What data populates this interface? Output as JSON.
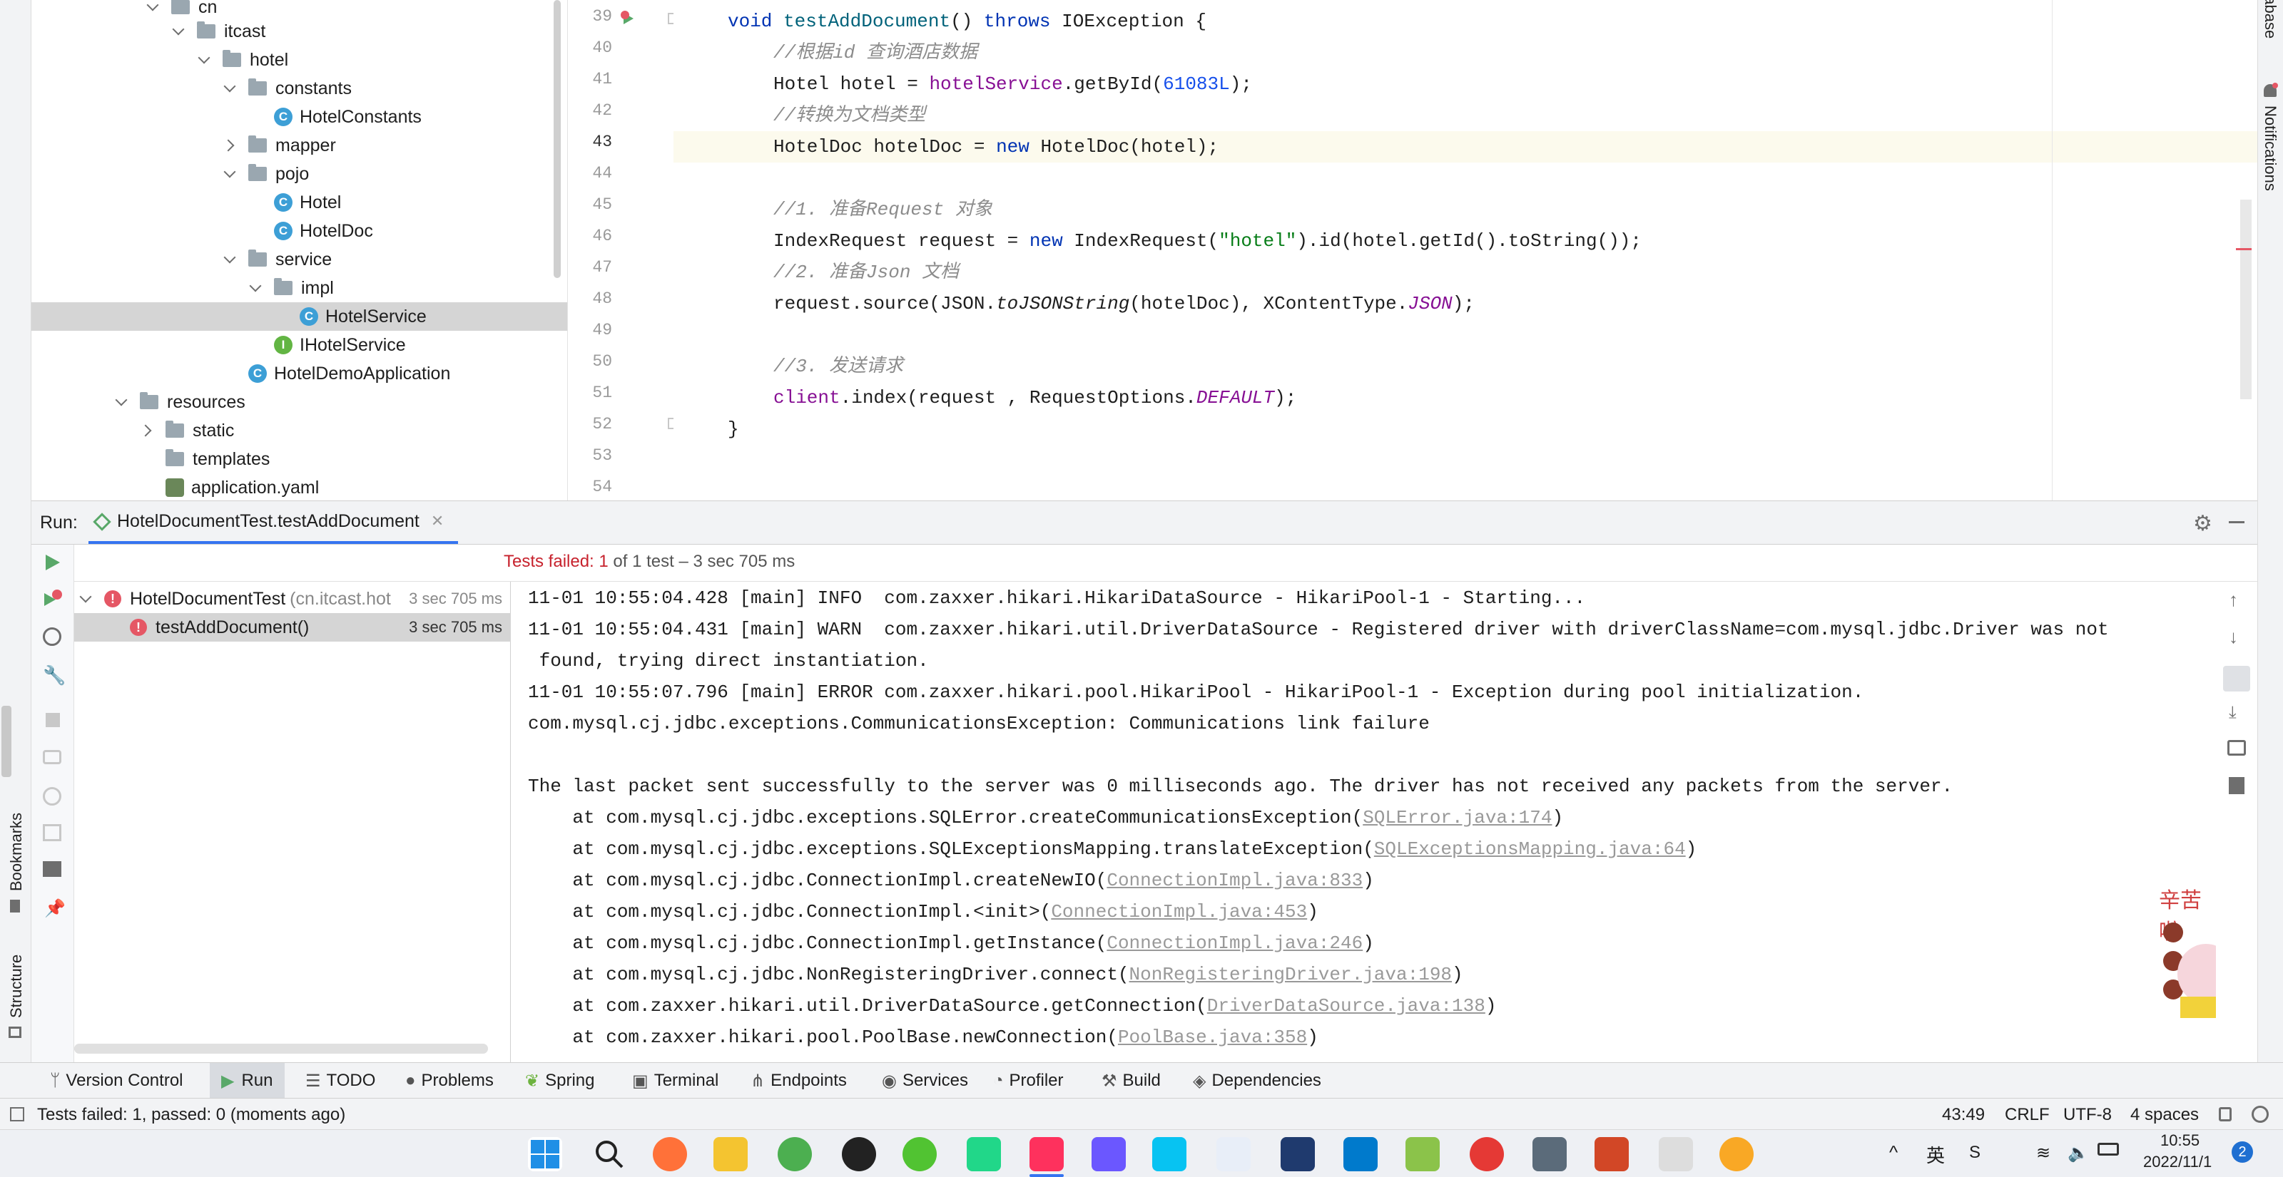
{
  "project_tree": {
    "items": [
      {
        "label": "cn",
        "type": "folder",
        "expanded": true
      },
      {
        "label": "itcast",
        "type": "folder",
        "expanded": true
      },
      {
        "label": "hotel",
        "type": "folder",
        "expanded": true
      },
      {
        "label": "constants",
        "type": "folder",
        "expanded": true
      },
      {
        "label": "HotelConstants",
        "type": "class"
      },
      {
        "label": "mapper",
        "type": "folder",
        "expanded": false
      },
      {
        "label": "pojo",
        "type": "folder",
        "expanded": true
      },
      {
        "label": "Hotel",
        "type": "class"
      },
      {
        "label": "HotelDoc",
        "type": "class"
      },
      {
        "label": "service",
        "type": "folder",
        "expanded": true
      },
      {
        "label": "impl",
        "type": "folder",
        "expanded": true
      },
      {
        "label": "HotelService",
        "type": "class",
        "selected": true
      },
      {
        "label": "IHotelService",
        "type": "interface"
      },
      {
        "label": "HotelDemoApplication",
        "type": "class"
      },
      {
        "label": "resources",
        "type": "folder",
        "expanded": true
      },
      {
        "label": "static",
        "type": "folder",
        "expanded": false
      },
      {
        "label": "templates",
        "type": "folder"
      },
      {
        "label": "application.yaml",
        "type": "yaml"
      }
    ]
  },
  "editor": {
    "current_line": "43",
    "line_numbers": [
      "39",
      "40",
      "41",
      "42",
      "43",
      "44",
      "45",
      "46",
      "47",
      "48",
      "49",
      "50",
      "51",
      "52",
      "53",
      "54"
    ],
    "lines": {
      "l39": {
        "kw1": "void",
        "method": "testAddDocument",
        "paren": "() ",
        "kw2": "throws",
        "rest": " IOException {"
      },
      "l40": {
        "comment": "//根据id 查询酒店数据"
      },
      "l41": {
        "a": "Hotel hotel = ",
        "field": "hotelService",
        "b": ".getById(",
        "num": "61083L",
        "c": ");"
      },
      "l42": {
        "comment": "//转换为文档类型"
      },
      "l43": {
        "a": "HotelDoc hotelDoc = ",
        "kw": "new",
        "b": " HotelDoc(hotel);"
      },
      "l45": {
        "comment": "//1. 准备Request 对象"
      },
      "l46": {
        "a": "IndexRequest request = ",
        "kw": "new",
        "b": " IndexRequest(",
        "str": "\"hotel\"",
        "c": ").id(hotel.getId().toString());"
      },
      "l47": {
        "comment": "//2. 准备Json 文档"
      },
      "l48": {
        "a": "request.source(JSON.",
        "italic": "toJSONString",
        "b": "(hotelDoc), XContentType.",
        "const": "JSON",
        "c": ");"
      },
      "l50": {
        "comment": "//3. 发送请求"
      },
      "l51": {
        "field": "client",
        "a": ".index(request , RequestOptions.",
        "const": "DEFAULT",
        "b": ");"
      },
      "l52": {
        "a": "}"
      }
    }
  },
  "right_stripe": {
    "database": "Database",
    "notifications": "Notifications"
  },
  "left_stripe": {
    "bookmarks": "Bookmarks",
    "structure": "Structure"
  },
  "run_panel": {
    "label": "Run:",
    "tab_title": "HotelDocumentTest.testAddDocument",
    "summary_prefix": "Tests failed: ",
    "summary_failed": "1",
    "summary_rest": " of 1 test – 3 sec 705 ms",
    "tests": [
      {
        "name": "HotelDocumentTest",
        "pkg": "(cn.itcast.hot",
        "time": "3 sec 705 ms"
      },
      {
        "name": "testAddDocument()",
        "time": "3 sec 705 ms"
      }
    ],
    "console": [
      {
        "text": "11-01 10:55:04.428 [main] INFO  com.zaxxer.hikari.HikariDataSource - HikariPool-1 - Starting..."
      },
      {
        "text": "11-01 10:55:04.431 [main] WARN  com.zaxxer.hikari.util.DriverDataSource - Registered driver with driverClassName=com.mysql.jdbc.Driver was not"
      },
      {
        "text": " found, trying direct instantiation."
      },
      {
        "text": "11-01 10:55:07.796 [main] ERROR com.zaxxer.hikari.pool.HikariPool - HikariPool-1 - Exception during pool initialization."
      },
      {
        "text": "com.mysql.cj.jdbc.exceptions.CommunicationsException: Communications link failure"
      },
      {
        "text": ""
      },
      {
        "text": "The last packet sent successfully to the server was 0 milliseconds ago. The driver has not received any packets from the server."
      },
      {
        "text": "    at com.mysql.cj.jdbc.exceptions.SQLError.createCommunicationsException(",
        "link": "SQLError.java:174",
        "end": ")"
      },
      {
        "text": "    at com.mysql.cj.jdbc.exceptions.SQLExceptionsMapping.translateException(",
        "link": "SQLExceptionsMapping.java:64",
        "end": ")"
      },
      {
        "text": "    at com.mysql.cj.jdbc.ConnectionImpl.createNewIO(",
        "link": "ConnectionImpl.java:833",
        "end": ")"
      },
      {
        "text": "    at com.mysql.cj.jdbc.ConnectionImpl.<init>(",
        "link": "ConnectionImpl.java:453",
        "end": ")"
      },
      {
        "text": "    at com.mysql.cj.jdbc.ConnectionImpl.getInstance(",
        "link": "ConnectionImpl.java:246",
        "end": ")"
      },
      {
        "text": "    at com.mysql.cj.jdbc.NonRegisteringDriver.connect(",
        "link": "NonRegisteringDriver.java:198",
        "end": ")"
      },
      {
        "text": "    at com.zaxxer.hikari.util.DriverDataSource.getConnection(",
        "link": "DriverDataSource.java:138",
        "end": ")"
      },
      {
        "text": "    at com.zaxxer.hikari.pool.PoolBase.newConnection(",
        "link": "PoolBase.java:358",
        "end": ")"
      }
    ],
    "sticker_text": "辛苦啦"
  },
  "tool_windows": [
    {
      "label": "Version Control",
      "icon": "version-control-icon"
    },
    {
      "label": "Run",
      "icon": "run-icon",
      "active": true
    },
    {
      "label": "TODO",
      "icon": "todo-icon"
    },
    {
      "label": "Problems",
      "icon": "problems-icon"
    },
    {
      "label": "Spring",
      "icon": "spring-icon"
    },
    {
      "label": "Terminal",
      "icon": "terminal-icon"
    },
    {
      "label": "Endpoints",
      "icon": "endpoints-icon"
    },
    {
      "label": "Services",
      "icon": "services-icon"
    },
    {
      "label": "Profiler",
      "icon": "profiler-icon"
    },
    {
      "label": "Build",
      "icon": "build-icon"
    },
    {
      "label": "Dependencies",
      "icon": "dependencies-icon"
    }
  ],
  "status_bar": {
    "message": "Tests failed: 1, passed: 0 (moments ago)",
    "position": "43:49",
    "line_sep": "CRLF",
    "encoding": "UTF-8",
    "indent": "4 spaces"
  },
  "taskbar": {
    "time": "10:55",
    "date": "2022/11/1",
    "lang": "英",
    "badge": "2"
  },
  "colors": {
    "accent": "#3574f0",
    "error": "#e55765",
    "keyword": "#0033b3",
    "string": "#067d17",
    "field": "#871094"
  }
}
